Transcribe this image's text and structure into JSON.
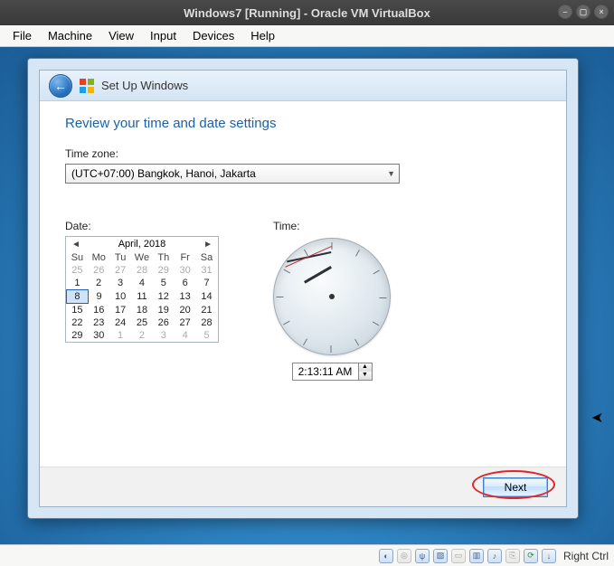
{
  "vm": {
    "title": "Windows7 [Running] - Oracle VM VirtualBox",
    "menu": {
      "file": "File",
      "machine": "Machine",
      "view": "View",
      "input": "Input",
      "devices": "Devices",
      "help": "Help"
    },
    "host_key": "Right Ctrl"
  },
  "dialog": {
    "wizard_name": "Set Up Windows",
    "heading": "Review your time and date settings",
    "timezone_label": "Time zone:",
    "timezone_value": "(UTC+07:00) Bangkok, Hanoi, Jakarta",
    "date_label": "Date:",
    "time_label": "Time:",
    "next": "Next"
  },
  "calendar": {
    "month": "April, 2018",
    "dow": {
      "su": "Su",
      "mo": "Mo",
      "tu": "Tu",
      "we": "We",
      "th": "Th",
      "fr": "Fr",
      "sa": "Sa"
    },
    "w1": {
      "c0": "25",
      "c1": "26",
      "c2": "27",
      "c3": "28",
      "c4": "29",
      "c5": "30",
      "c6": "31"
    },
    "w2": {
      "c0": "1",
      "c1": "2",
      "c2": "3",
      "c3": "4",
      "c4": "5",
      "c5": "6",
      "c6": "7"
    },
    "w3": {
      "c0": "8",
      "c1": "9",
      "c2": "10",
      "c3": "11",
      "c4": "12",
      "c5": "13",
      "c6": "14"
    },
    "w4": {
      "c0": "15",
      "c1": "16",
      "c2": "17",
      "c3": "18",
      "c4": "19",
      "c5": "20",
      "c6": "21"
    },
    "w5": {
      "c0": "22",
      "c1": "23",
      "c2": "24",
      "c3": "25",
      "c4": "26",
      "c5": "27",
      "c6": "28"
    },
    "w6": {
      "c0": "29",
      "c1": "30",
      "c2": "1",
      "c3": "2",
      "c4": "3",
      "c5": "4",
      "c6": "5"
    },
    "selected_day": "8"
  },
  "time": {
    "display": "2:13:11 AM"
  }
}
